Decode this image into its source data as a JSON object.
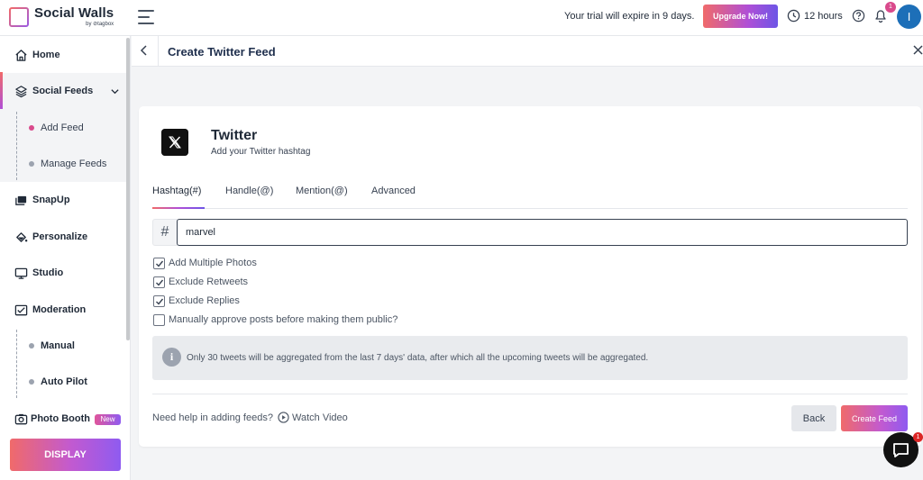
{
  "app": {
    "name": "Social Walls",
    "by": "by ⊘tagbox"
  },
  "topbar": {
    "trial_text": "Your trial will expire in 9 days.",
    "upgrade_label": "Upgrade Now!",
    "hours_text": "12 hours",
    "notification_count": "1",
    "avatar_initial": "I"
  },
  "sidebar": {
    "home": "Home",
    "social_feeds": "Social Feeds",
    "add_feed": "Add Feed",
    "manage_feeds": "Manage Feeds",
    "snapup": "SnapUp",
    "personalize": "Personalize",
    "studio": "Studio",
    "moderation": "Moderation",
    "manual": "Manual",
    "auto_pilot": "Auto Pilot",
    "photo_booth": "Photo Booth",
    "new_badge": "New",
    "display_button": "DISPLAY"
  },
  "header": {
    "title": "Create Twitter Feed"
  },
  "form": {
    "platform_name": "Twitter",
    "platform_subtitle": "Add your Twitter hashtag",
    "tabs": [
      "Hashtag(#)",
      "Handle(@)",
      "Mention(@)",
      "Advanced"
    ],
    "hash_symbol": "#",
    "hashtag_value": "marvel",
    "options": [
      {
        "label": "Add Multiple Photos",
        "checked": true
      },
      {
        "label": "Exclude Retweets",
        "checked": true
      },
      {
        "label": "Exclude Replies",
        "checked": true
      },
      {
        "label": "Manually approve posts before making them public?",
        "checked": false
      }
    ],
    "info_note": "Only 30 tweets will be aggregated from the last 7 days' data, after which all the upcoming tweets will be aggregated.",
    "help_text": "Need help in adding feeds?",
    "watch_video": "Watch Video",
    "back_label": "Back",
    "create_label": "Create Feed"
  },
  "chat": {
    "badge_count": "1"
  },
  "colors": {
    "accent_gradient_start": "#f06a6a",
    "accent_gradient_end": "#6d55e6",
    "avatar": "#1d6fb8",
    "notification_badge": "#d94a8c"
  }
}
